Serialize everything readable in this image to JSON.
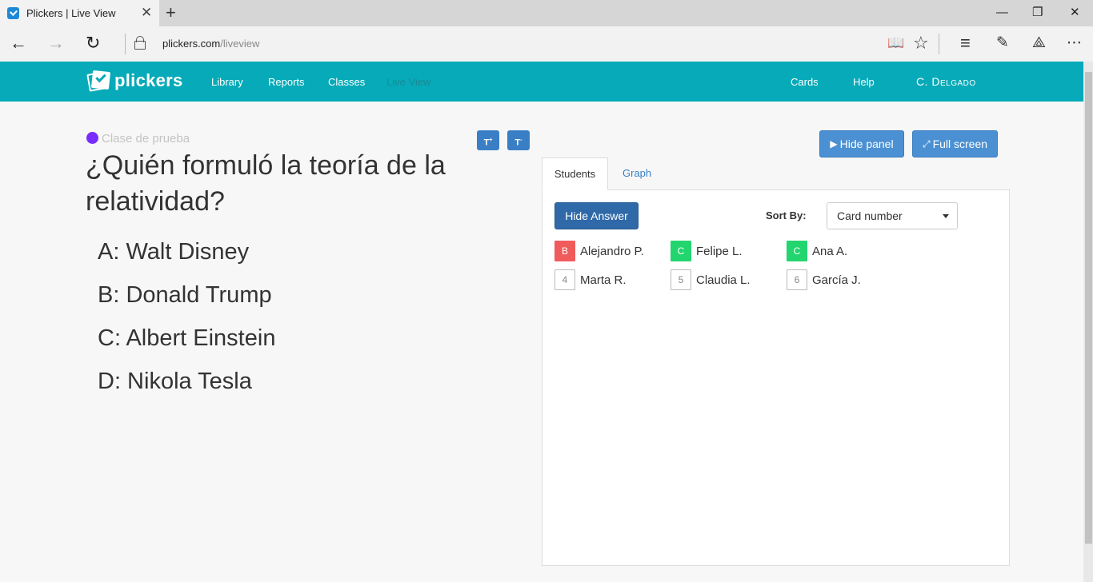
{
  "browser": {
    "tab_title": "Plickers | Live View",
    "tab_close": "✕",
    "new_tab": "+",
    "url_host": "plickers.com",
    "url_path": "/liveview",
    "win_minimize": "—",
    "win_restore": "❐",
    "win_close": "✕",
    "back": "←",
    "forward": "→",
    "refresh": "↻",
    "reading_view": "📖",
    "favorite": "☆",
    "hub": "≡",
    "notes": "✎",
    "share": "⟁",
    "more": "⋯"
  },
  "nav": {
    "logo_text": "plickers",
    "links": [
      {
        "label": "Library"
      },
      {
        "label": "Reports"
      },
      {
        "label": "Classes"
      },
      {
        "label": "Live View"
      }
    ],
    "cards": "Cards",
    "help": "Help",
    "user": "C. Delgado"
  },
  "question": {
    "class_name": "Clase de prueba",
    "class_color": "#7a2cff",
    "increase_text": "T",
    "increase_mark": "+",
    "decrease_text": "T",
    "decrease_mark": "-",
    "text": "¿Quién formuló la teoría de la relatividad?",
    "answers": [
      "A: Walt Disney",
      "B: Donald Trump",
      "C: Albert Einstein",
      "D: Nikola Tesla"
    ]
  },
  "panel": {
    "hide_panel": "Hide panel",
    "full_screen": "Full screen",
    "hide_panel_icon": "▶",
    "full_screen_icon": "⤢",
    "tabs": {
      "students": "Students",
      "graph": "Graph"
    },
    "hide_answer": "Hide Answer",
    "sort_label": "Sort By:",
    "sort_value": "Card number",
    "students": [
      {
        "badge": "B",
        "status": "wrong",
        "name": "Alejandro P."
      },
      {
        "badge": "C",
        "status": "right",
        "name": "Felipe L."
      },
      {
        "badge": "C",
        "status": "right",
        "name": "Ana A."
      },
      {
        "badge": "4",
        "status": "none",
        "name": "Marta R."
      },
      {
        "badge": "5",
        "status": "none",
        "name": "Claudia L."
      },
      {
        "badge": "6",
        "status": "none",
        "name": "García J."
      }
    ]
  },
  "colors": {
    "nav_bg": "#06aab8",
    "wrong": "#f05b5b",
    "right": "#23d56e",
    "button": "#4a90d2"
  }
}
